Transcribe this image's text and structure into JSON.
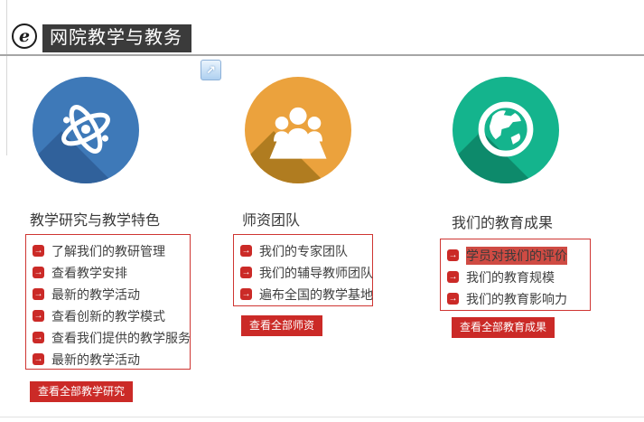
{
  "header": {
    "logo_glyph": "e",
    "title": "网院教学与教务",
    "expand_glyph": "↗"
  },
  "icons": {
    "arrow_glyph": "→"
  },
  "theme": {
    "red": "#cb2a27",
    "box_border_red": "#cf3532",
    "highlight_red": "#cf4b43",
    "title_bar_bg": "#3b3b3b",
    "divider_gray": "#a6a6a6",
    "circle_blue": "#3e79b8",
    "circle_blue_shadow": "#30619b",
    "circle_orange": "#eba23d",
    "circle_orange_shadow": "#b07c20",
    "circle_green": "#14b48d",
    "circle_green_shadow": "#0d8a6b"
  },
  "columns": [
    {
      "title": "教学研究与教学特色",
      "icon": "atom-icon",
      "links": [
        "了解我们的教研管理",
        "查看教学安排",
        "最新的教学活动",
        "查看创新的教学模式",
        "查看我们提供的教学服务",
        "最新的教学活动"
      ],
      "button": "查看全部教学研究"
    },
    {
      "title": "师资团队",
      "icon": "team-icon",
      "links": [
        "我们的专家团队",
        "我们的辅导教师团队",
        "遍布全国的教学基地"
      ],
      "button": "查看全部师资"
    },
    {
      "title": "我们的教育成果",
      "icon": "globe-icon",
      "links": [
        "学员对我们的评价",
        "我们的教育规模",
        "我们的教育影响力"
      ],
      "highlighted_link_index": 0,
      "button": "查看全部教育成果"
    }
  ]
}
